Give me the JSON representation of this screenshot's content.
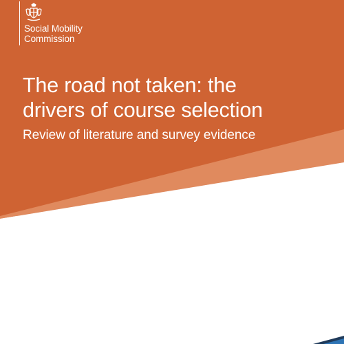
{
  "colors": {
    "primary_orange": "#CF6333",
    "light_orange": "#E08A5E",
    "white": "#FFFFFF",
    "navy": "#1F3A5A",
    "blue": "#2E74B5"
  },
  "logo": {
    "icon": "royal-coat-of-arms-icon",
    "line1": "Social Mobility",
    "line2": "Commission"
  },
  "title": {
    "line1": "The road not taken: the",
    "line2": "drivers of course selection"
  },
  "subtitle": "Review of literature and survey evidence"
}
